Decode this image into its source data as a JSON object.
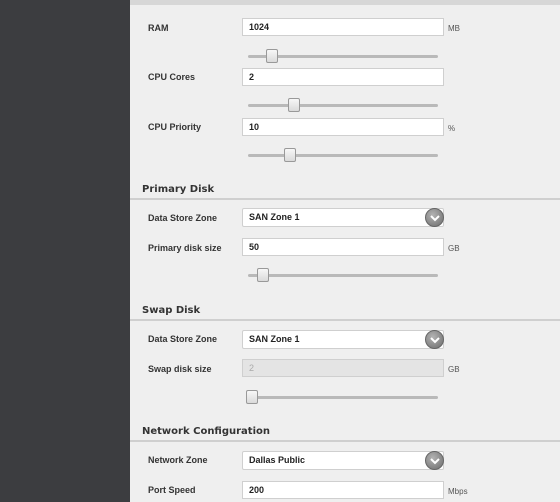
{
  "form": {
    "ram": {
      "label": "RAM",
      "value": "1024",
      "unit": "MB",
      "slider": 0.12
    },
    "cpu_cores": {
      "label": "CPU Cores",
      "value": "2",
      "slider": 0.25
    },
    "cpu_priority": {
      "label": "CPU Priority",
      "value": "10",
      "unit": "%",
      "slider": 0.22
    }
  },
  "primary_disk": {
    "title": "Primary Disk",
    "zone_label": "Data Store Zone",
    "zone_value": "SAN Zone 1",
    "size_label": "Primary disk size",
    "size_value": "50",
    "size_unit": "GB",
    "slider": 0.08
  },
  "swap_disk": {
    "title": "Swap Disk",
    "zone_label": "Data Store Zone",
    "zone_value": "SAN Zone 1",
    "size_label": "Swap disk size",
    "size_value": "2",
    "size_unit": "GB",
    "slider": 0.0
  },
  "network": {
    "title": "Network Configuration",
    "zone_label": "Network Zone",
    "zone_value": "Dallas Public",
    "speed_label": "Port Speed",
    "speed_value": "200",
    "speed_unit": "Mbps"
  }
}
